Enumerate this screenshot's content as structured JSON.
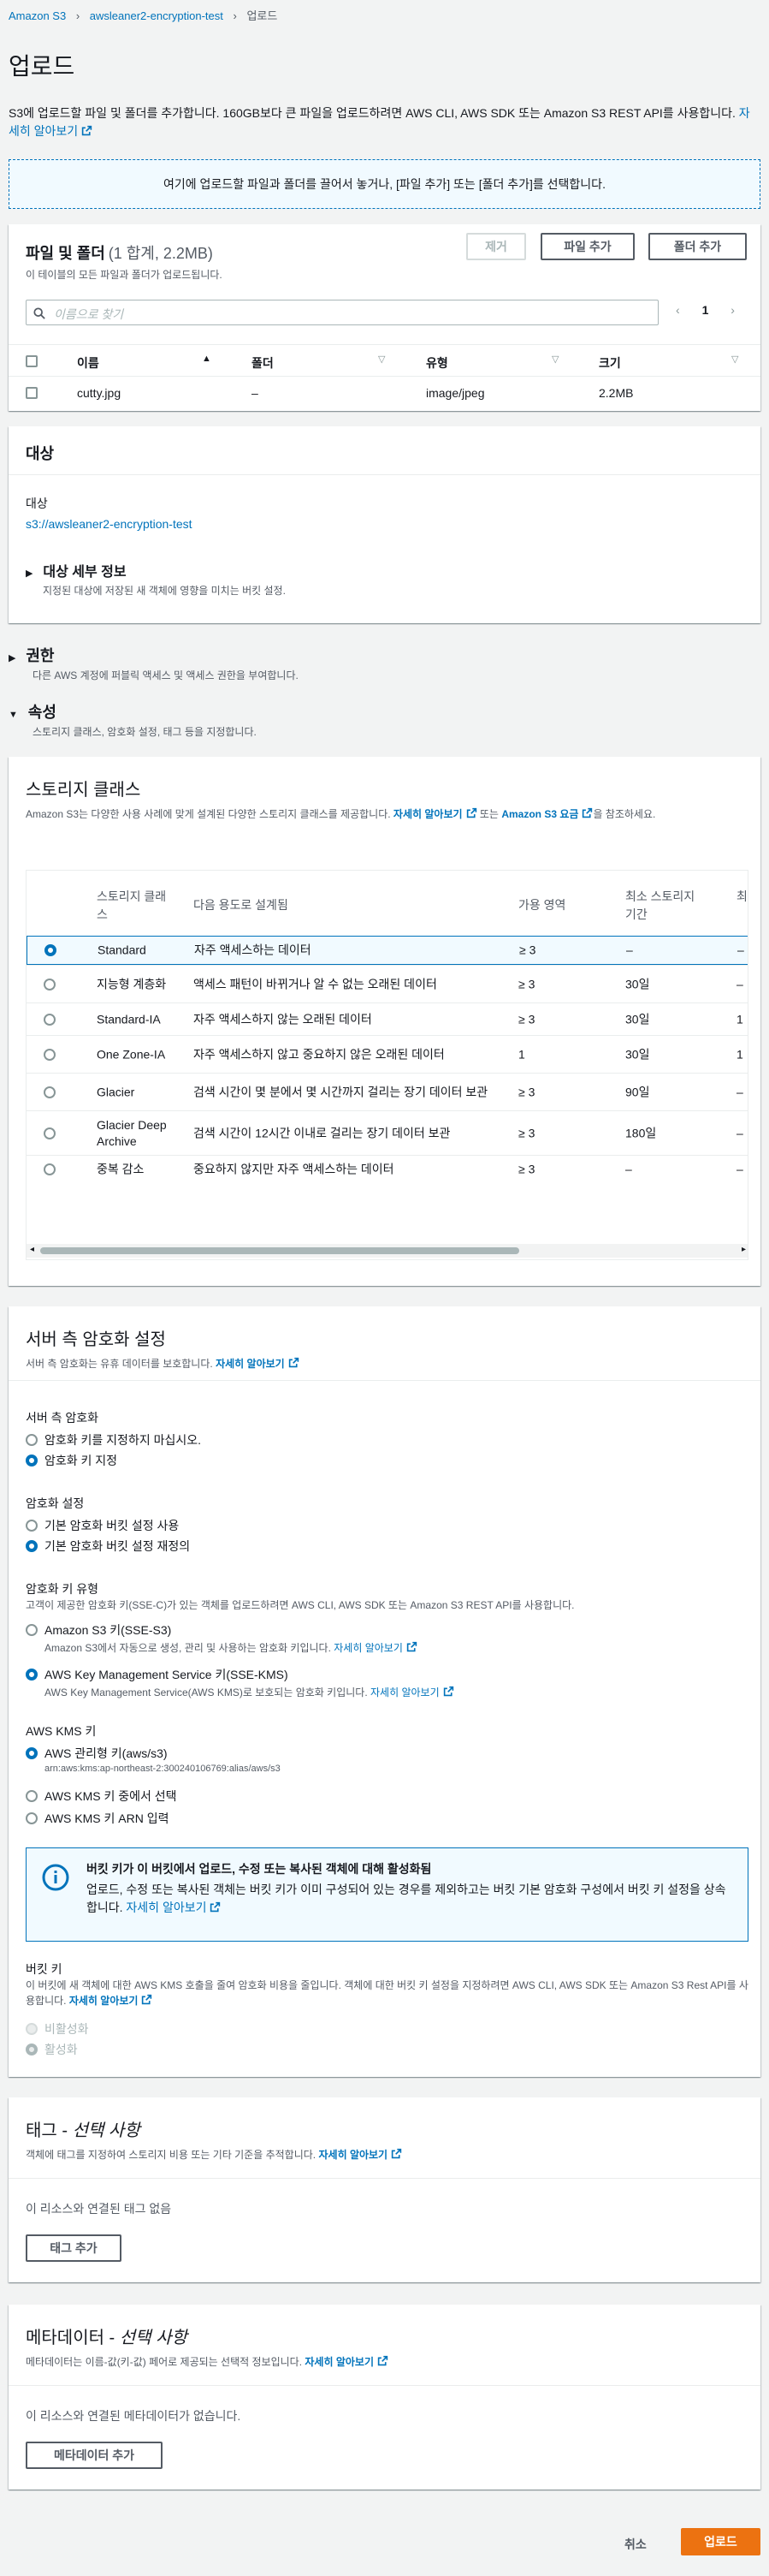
{
  "breadcrumb": {
    "root": "Amazon S3",
    "bucket": "awsleaner2-encryption-test",
    "current": "업로드"
  },
  "page": {
    "title": "업로드",
    "desc": "S3에 업로드할 파일 및 폴더를 추가합니다. 160GB보다 큰 파일을 업로드하려면 AWS CLI, AWS SDK 또는 Amazon S3 REST API를 사용합니다.",
    "desc_link": "자세히 알아보기"
  },
  "dropzone": {
    "text": "여기에 업로드할 파일과 폴더를 끌어서 놓거나, [파일 추가] 또는 [폴더 추가]를 선택합니다."
  },
  "files": {
    "title": "파일 및 폴더",
    "count": "(1 합계, 2.2MB)",
    "subtitle": "이 테이블의 모든 파일과 폴더가 업로드됩니다.",
    "btn_remove": "제거",
    "btn_add_file": "파일 추가",
    "btn_add_folder": "폴더 추가",
    "search_placeholder": "이름으로 찾기",
    "page": "1",
    "columns": [
      "이름",
      "폴더",
      "유형",
      "크기"
    ],
    "rows": [
      {
        "name": "cutty.jpg",
        "folder": "–",
        "type": "image/jpeg",
        "size": "2.2MB"
      }
    ]
  },
  "destination": {
    "title": "대상",
    "label": "대상",
    "value": "s3://awsleaner2-encryption-test",
    "details_title": "대상 세부 정보",
    "details_desc": "지정된 대상에 저장된 새 객체에 영향을 미치는 버킷 설정."
  },
  "permissions": {
    "title": "권한",
    "desc": "다른 AWS 계정에 퍼블릭 액세스 및 액세스 권한을 부여합니다."
  },
  "properties": {
    "title": "속성",
    "desc": "스토리지 클래스, 암호화 설정, 태그 등을 지정합니다."
  },
  "storage": {
    "title": "스토리지 클래스",
    "desc_a": "Amazon S3는 다양한 사용 사례에 맞게 설계된 다양한 스토리지 클래스를 제공합니다.",
    "link1": "자세히 알아보기",
    "desc_b": "또는",
    "link2": "Amazon S3 요금",
    "desc_c": "을 참조하세요.",
    "columns": [
      "스토리지 클래스",
      "다음 용도로 설계됨",
      "가용 영역",
      "최소 스토리지 기간",
      "최"
    ],
    "rows": [
      {
        "name": "Standard",
        "use": "자주 액세스하는 데이터",
        "az": "≥ 3",
        "min": "–",
        "extra": "–",
        "selected": true
      },
      {
        "name": "지능형 계층화",
        "use": "액세스 패턴이 바뀌거나 알 수 없는 오래된 데이터",
        "az": "≥ 3",
        "min": "30일",
        "extra": "–",
        "selected": false
      },
      {
        "name": "Standard-IA",
        "use": "자주 액세스하지 않는 오래된 데이터",
        "az": "≥ 3",
        "min": "30일",
        "extra": "1",
        "selected": false
      },
      {
        "name": "One Zone-IA",
        "use": "자주 액세스하지 않고 중요하지 않은 오래된 데이터",
        "az": "1",
        "min": "30일",
        "extra": "1",
        "selected": false
      },
      {
        "name": "Glacier",
        "use": "검색 시간이 몇 분에서 몇 시간까지 걸리는 장기 데이터 보관",
        "az": "≥ 3",
        "min": "90일",
        "extra": "–",
        "selected": false
      },
      {
        "name": "Glacier Deep Archive",
        "use": "검색 시간이 12시간 이내로 걸리는 장기 데이터 보관",
        "az": "≥ 3",
        "min": "180일",
        "extra": "–",
        "selected": false
      },
      {
        "name": "중복 감소",
        "use": "중요하지 않지만 자주 액세스하는 데이터",
        "az": "≥ 3",
        "min": "–",
        "extra": "–",
        "selected": false
      }
    ]
  },
  "encryption": {
    "title": "서버 측 암호화 설정",
    "desc": "서버 측 암호화는 유휴 데이터를 보호합니다.",
    "link": "자세히 알아보기",
    "sse_label": "서버 측 암호화",
    "sse_opt1": "암호화 키를 지정하지 마십시오.",
    "sse_opt2": "암호화 키 지정",
    "set_label": "암호화 설정",
    "set_opt1": "기본 암호화 버킷 설정 사용",
    "set_opt2": "기본 암호화 버킷 설정 재정의",
    "keytype_label": "암호화 키 유형",
    "keytype_desc": "고객이 제공한 암호화 키(SSE-C)가 있는 객체를 업로드하려면 AWS CLI, AWS SDK 또는 Amazon S3 REST API를 사용합니다.",
    "kt1_title": "Amazon S3 키(SSE-S3)",
    "kt1_desc": "Amazon S3에서 자동으로 생성, 관리 및 사용하는 암호화 키입니다.",
    "kt1_link": "자세히 알아보기",
    "kt2_title": "AWS Key Management Service 키(SSE-KMS)",
    "kt2_desc": "AWS Key Management Service(AWS KMS)로 보호되는 암호화 키입니다.",
    "kt2_link": "자세히 알아보기",
    "kms_label": "AWS KMS 키",
    "kms_opt1": "AWS 관리형 키(aws/s3)",
    "kms_opt1_arn": "arn:aws:kms:ap-northeast-2:300240106769:alias/aws/s3",
    "kms_opt2": "AWS KMS 키 중에서 선택",
    "kms_opt3": "AWS KMS 키 ARN 입력",
    "alert_title": "버킷 키가 이 버킷에서 업로드, 수정 또는 복사된 객체에 대해 활성화됨",
    "alert_body": "업로드, 수정 또는 복사된 객체는 버킷 키가 이미 구성되어 있는 경우를 제외하고는 버킷 기본 암호화 구성에서 버킷 키 설정을 상속합니다.",
    "alert_link": "자세히 알아보기",
    "bucketkey_label": "버킷 키",
    "bucketkey_desc": "이 버킷에 새 객체에 대한 AWS KMS 호출을 줄여 암호화 비용을 줄입니다. 객체에 대한 버킷 키 설정을 지정하려면 AWS CLI, AWS SDK 또는 Amazon S3 Rest API를 사용합니다.",
    "bucketkey_link": "자세히 알아보기",
    "bk_opt1": "비활성화",
    "bk_opt2": "활성화"
  },
  "tags": {
    "title": "태그 - ",
    "title_opt": "선택 사항",
    "desc": "객체에 태그를 지정하여 스토리지 비용 또는 기타 기준을 추적합니다.",
    "link": "자세히 알아보기",
    "empty": "이 리소스와 연결된 태그 없음",
    "btn": "태그 추가"
  },
  "metadata": {
    "title": "메타데이터 - ",
    "title_opt": "선택 사항",
    "desc": "메타데이터는 이름-값(키-값) 페어로 제공되는 선택적 정보입니다.",
    "link": "자세히 알아보기",
    "empty": "이 리소스와 연결된 메타데이터가 없습니다.",
    "btn": "메타데이터 추가"
  },
  "footer": {
    "cancel": "취소",
    "upload": "업로드"
  }
}
